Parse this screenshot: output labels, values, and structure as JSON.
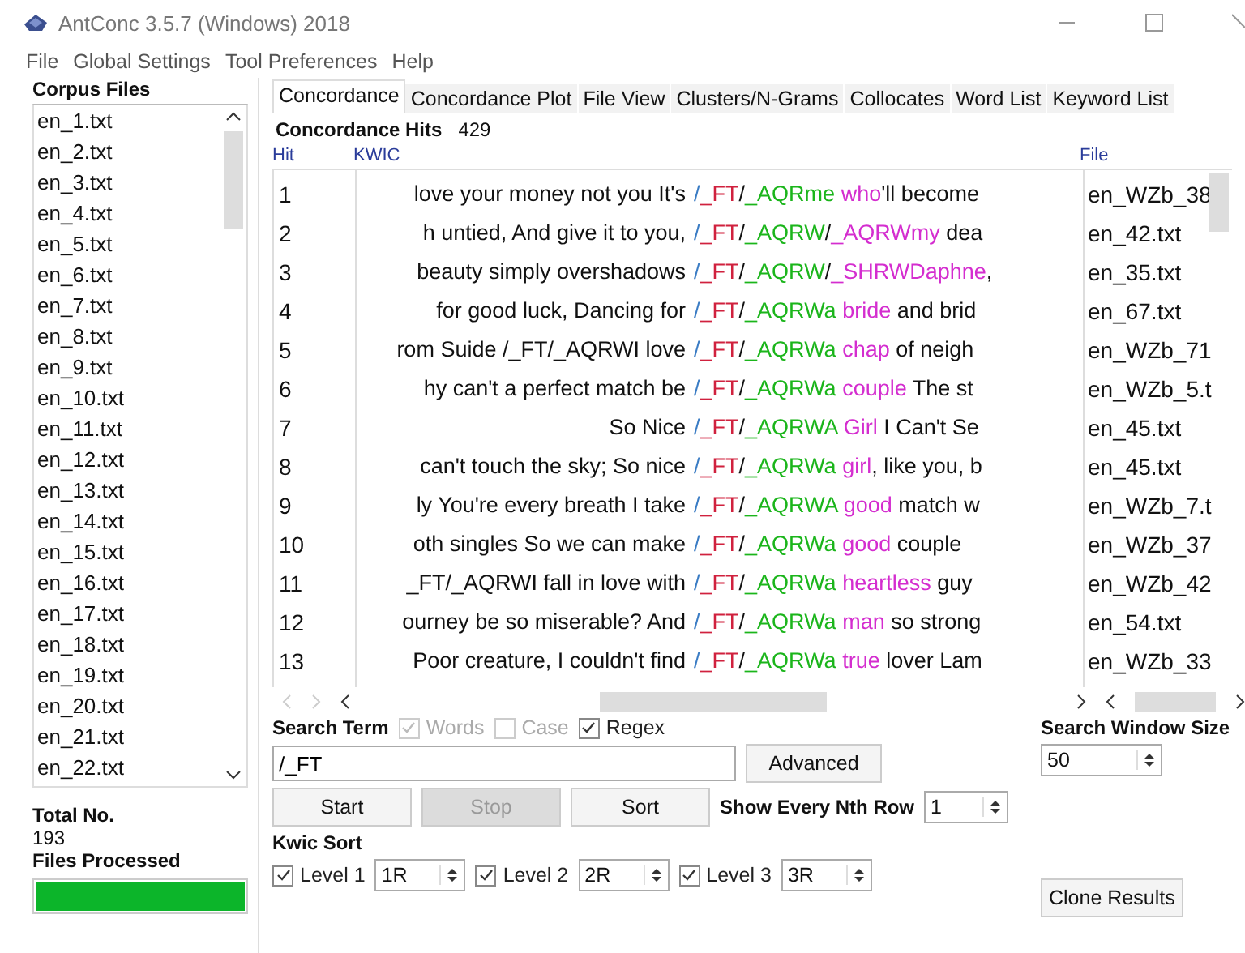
{
  "window": {
    "title": "AntConc 3.5.7 (Windows) 2018"
  },
  "menu": [
    "File",
    "Global Settings",
    "Tool Preferences",
    "Help"
  ],
  "sidebar": {
    "heading": "Corpus Files",
    "files": [
      "en_1.txt",
      "en_2.txt",
      "en_3.txt",
      "en_4.txt",
      "en_5.txt",
      "en_6.txt",
      "en_7.txt",
      "en_8.txt",
      "en_9.txt",
      "en_10.txt",
      "en_11.txt",
      "en_12.txt",
      "en_13.txt",
      "en_14.txt",
      "en_15.txt",
      "en_16.txt",
      "en_17.txt",
      "en_18.txt",
      "en_19.txt",
      "en_20.txt",
      "en_21.txt",
      "en_22.txt"
    ],
    "total_label": "Total No.",
    "total": "193",
    "processed_label": "Files Processed",
    "progress": {
      "level": 1
    }
  },
  "tabs": [
    {
      "label": "Concordance",
      "selected": true
    },
    {
      "label": "Concordance Plot",
      "selected": false
    },
    {
      "label": "File View",
      "selected": false
    },
    {
      "label": "Clusters/N-Grams",
      "selected": false
    },
    {
      "label": "Collocates",
      "selected": false
    },
    {
      "label": "Word List",
      "selected": false
    },
    {
      "label": "Keyword List",
      "selected": false
    }
  ],
  "hits_label": "Concordance Hits",
  "hits_count": "429",
  "table": {
    "columns": [
      "Hit",
      "KWIC",
      "File"
    ],
    "rows": [
      {
        "hit": "1",
        "left": "love your money not you It's",
        "node": [
          {
            "kind": "sep",
            "text": "/"
          },
          {
            "kind": "ft",
            "text": "_FT"
          },
          {
            "kind": "plain",
            "text": "/"
          },
          {
            "kind": "tag",
            "text": "_AQRme"
          },
          {
            "kind": "hit",
            "text": " who"
          },
          {
            "kind": "plain",
            "text": "'ll become"
          }
        ],
        "file": "en_WZb_38"
      },
      {
        "hit": "2",
        "left": "h untied, And give it to you,",
        "node": [
          {
            "kind": "sep",
            "text": "/"
          },
          {
            "kind": "ft",
            "text": "_FT"
          },
          {
            "kind": "plain",
            "text": "/"
          },
          {
            "kind": "tag",
            "text": "_AQRW"
          },
          {
            "kind": "plain",
            "text": "/"
          },
          {
            "kind": "hit",
            "text": "_AQRWmy"
          },
          {
            "kind": "plain",
            "text": " dea"
          }
        ],
        "file": "en_42.txt"
      },
      {
        "hit": "3",
        "left": "beauty simply overshadows",
        "node": [
          {
            "kind": "sep",
            "text": "/"
          },
          {
            "kind": "ft",
            "text": "_FT"
          },
          {
            "kind": "plain",
            "text": "/"
          },
          {
            "kind": "tag",
            "text": "_AQRW"
          },
          {
            "kind": "plain",
            "text": "/"
          },
          {
            "kind": "hit",
            "text": "_SHRWDaphne"
          },
          {
            "kind": "plain",
            "text": ","
          }
        ],
        "file": "en_35.txt"
      },
      {
        "hit": "4",
        "left": "for good luck,  Dancing for",
        "node": [
          {
            "kind": "sep",
            "text": "/"
          },
          {
            "kind": "ft",
            "text": "_FT"
          },
          {
            "kind": "plain",
            "text": "/"
          },
          {
            "kind": "tag",
            "text": "_AQRWa"
          },
          {
            "kind": "hit",
            "text": " bride"
          },
          {
            "kind": "plain",
            "text": " and brid"
          }
        ],
        "file": "en_67.txt"
      },
      {
        "hit": "5",
        "left": "rom Suide /_FT/_AQRWI love",
        "node": [
          {
            "kind": "sep",
            "text": "/"
          },
          {
            "kind": "ft",
            "text": "_FT"
          },
          {
            "kind": "plain",
            "text": "/"
          },
          {
            "kind": "tag",
            "text": "_AQRWa"
          },
          {
            "kind": "hit",
            "text": " chap"
          },
          {
            "kind": "plain",
            "text": " of neigh"
          }
        ],
        "file": "en_WZb_71"
      },
      {
        "hit": "6",
        "left": "hy can't a perfect match be",
        "node": [
          {
            "kind": "sep",
            "text": "/"
          },
          {
            "kind": "ft",
            "text": "_FT"
          },
          {
            "kind": "plain",
            "text": "/"
          },
          {
            "kind": "tag",
            "text": "_AQRWa"
          },
          {
            "kind": "hit",
            "text": " couple"
          },
          {
            "kind": "plain",
            "text": " The st"
          }
        ],
        "file": "en_WZb_5.t"
      },
      {
        "hit": "7",
        "left": "So Nice",
        "node": [
          {
            "kind": "sep",
            "text": "/"
          },
          {
            "kind": "ft",
            "text": "_FT"
          },
          {
            "kind": "plain",
            "text": "/"
          },
          {
            "kind": "tag",
            "text": "_AQRWA"
          },
          {
            "kind": "hit",
            "text": " Girl"
          },
          {
            "kind": "plain",
            "text": " I Can't Se"
          }
        ],
        "file": "en_45.txt"
      },
      {
        "hit": "8",
        "left": "can't touch the sky; So nice",
        "node": [
          {
            "kind": "sep",
            "text": "/"
          },
          {
            "kind": "ft",
            "text": "_FT"
          },
          {
            "kind": "plain",
            "text": "/"
          },
          {
            "kind": "tag",
            "text": "_AQRWa"
          },
          {
            "kind": "hit",
            "text": " girl"
          },
          {
            "kind": "plain",
            "text": ", like you, b"
          }
        ],
        "file": "en_45.txt"
      },
      {
        "hit": "9",
        "left": "ly You're every breath I take",
        "node": [
          {
            "kind": "sep",
            "text": "/"
          },
          {
            "kind": "ft",
            "text": "_FT"
          },
          {
            "kind": "plain",
            "text": "/"
          },
          {
            "kind": "tag",
            "text": "_AQRWA"
          },
          {
            "kind": "hit",
            "text": " good"
          },
          {
            "kind": "plain",
            "text": " match w"
          }
        ],
        "file": "en_WZb_7.t"
      },
      {
        "hit": "10",
        "left": "oth singles So we can make",
        "node": [
          {
            "kind": "sep",
            "text": "/"
          },
          {
            "kind": "ft",
            "text": "_FT"
          },
          {
            "kind": "plain",
            "text": "/"
          },
          {
            "kind": "tag",
            "text": "_AQRWa"
          },
          {
            "kind": "hit",
            "text": " good"
          },
          {
            "kind": "plain",
            "text": " couple"
          }
        ],
        "file": "en_WZb_37"
      },
      {
        "hit": "11",
        "left": "_FT/_AQRWI fall in love with",
        "node": [
          {
            "kind": "sep",
            "text": "/"
          },
          {
            "kind": "ft",
            "text": "_FT"
          },
          {
            "kind": "plain",
            "text": "/"
          },
          {
            "kind": "tag",
            "text": "_AQRWa"
          },
          {
            "kind": "hit",
            "text": " heartless"
          },
          {
            "kind": "plain",
            "text": " guy"
          }
        ],
        "file": "en_WZb_42"
      },
      {
        "hit": "12",
        "left": "ourney be so miserable? And",
        "node": [
          {
            "kind": "sep",
            "text": "/"
          },
          {
            "kind": "ft",
            "text": "_FT"
          },
          {
            "kind": "plain",
            "text": "/"
          },
          {
            "kind": "tag",
            "text": "_AQRWa"
          },
          {
            "kind": "hit",
            "text": " man"
          },
          {
            "kind": "plain",
            "text": " so strong"
          }
        ],
        "file": "en_54.txt"
      },
      {
        "hit": "13",
        "left": "Poor creature, I couldn't find",
        "node": [
          {
            "kind": "sep",
            "text": "/"
          },
          {
            "kind": "ft",
            "text": "_FT"
          },
          {
            "kind": "plain",
            "text": "/"
          },
          {
            "kind": "tag",
            "text": "_AQRWa"
          },
          {
            "kind": "hit",
            "text": " true"
          },
          {
            "kind": "plain",
            "text": " lover Lam"
          }
        ],
        "file": "en_WZb_33"
      }
    ]
  },
  "search": {
    "label": "Search Term",
    "options": [
      {
        "label": "Words",
        "checked": true,
        "disabled": true
      },
      {
        "label": "Case",
        "checked": false,
        "disabled": true
      },
      {
        "label": "Regex",
        "checked": true,
        "disabled": false
      }
    ],
    "value": "/_FT",
    "advanced": "Advanced"
  },
  "window_size": {
    "label": "Search Window Size",
    "value": "50"
  },
  "buttons": [
    {
      "label": "Start",
      "disabled": false
    },
    {
      "label": "Stop",
      "disabled": true
    },
    {
      "label": "Sort",
      "disabled": false
    }
  ],
  "nth_row": {
    "label": "Show Every Nth Row",
    "value": "1"
  },
  "kwic_sort": {
    "label": "Kwic Sort",
    "levels": [
      {
        "label": "Level 1",
        "checked": true,
        "value": "1R"
      },
      {
        "label": "Level 2",
        "checked": true,
        "value": "2R"
      },
      {
        "label": "Level 3",
        "checked": true,
        "value": "3R"
      }
    ]
  },
  "clone": "Clone Results"
}
